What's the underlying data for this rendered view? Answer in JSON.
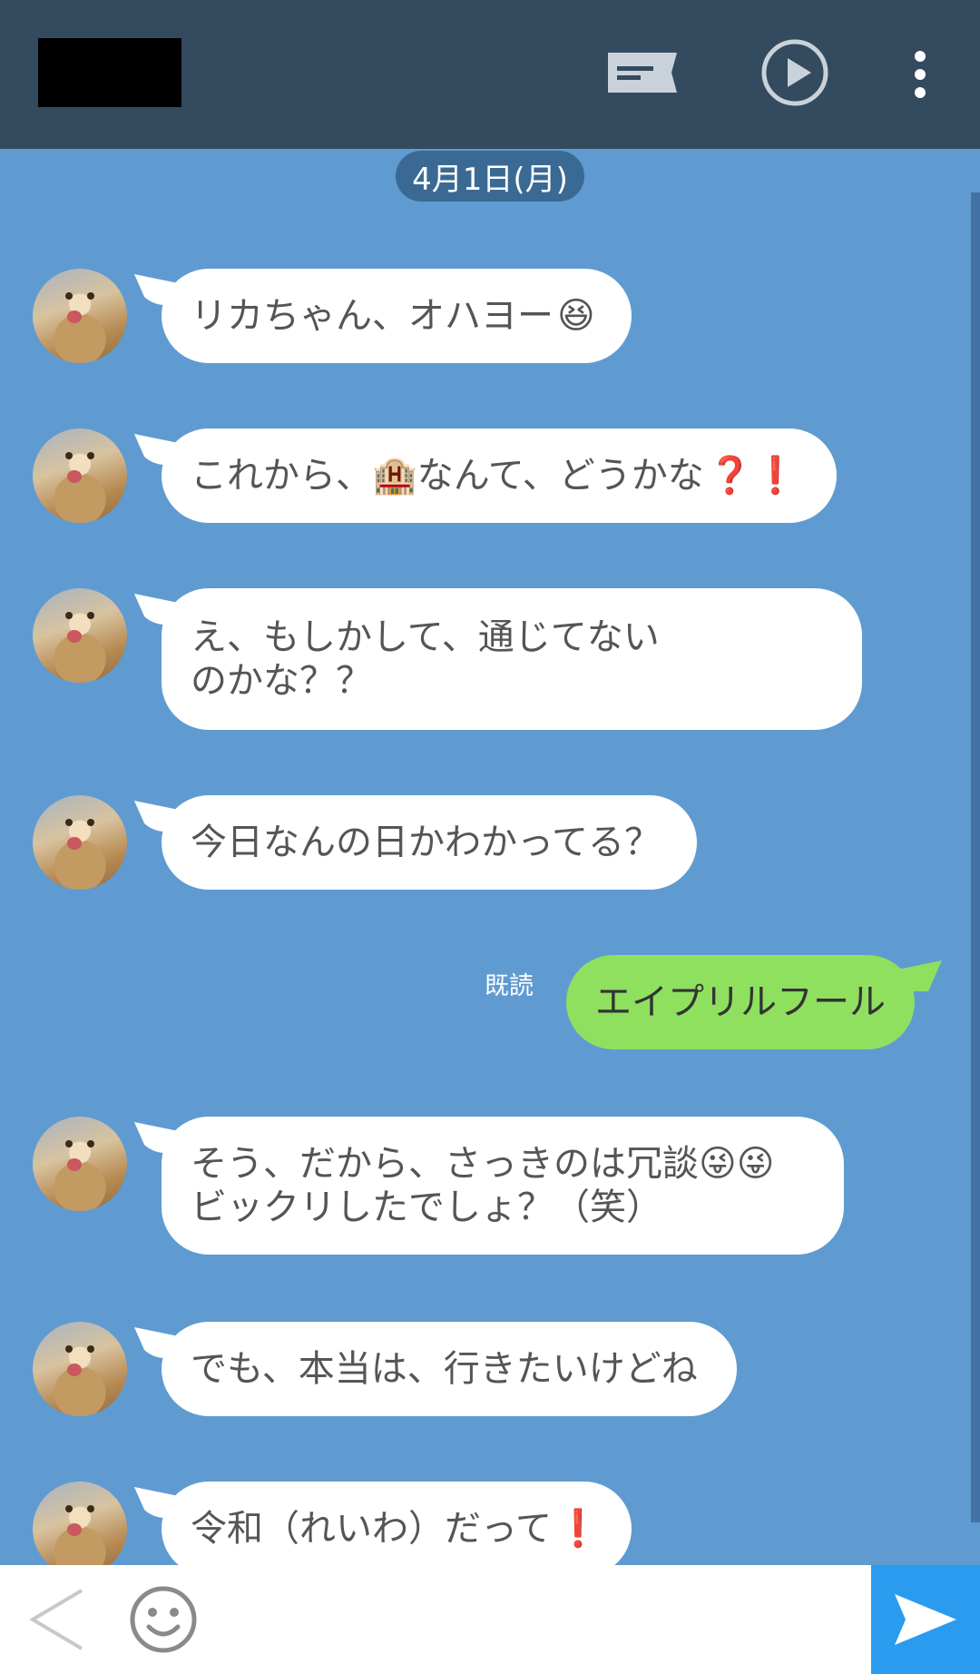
{
  "header": {
    "title_redacted": true,
    "icons": [
      "message-icon",
      "play-circle-icon",
      "more-vertical-icon"
    ]
  },
  "date": "4月1日(月)",
  "messages": [
    {
      "side": "left",
      "text": "リカちゃん、オハヨー",
      "emoji": "😆"
    },
    {
      "side": "left",
      "text": "これから、🏨なんて、どうかな",
      "emoji": "❓❗"
    },
    {
      "side": "left",
      "text": "え、もしかして、通じてない\nのかな？？",
      "emoji": ""
    },
    {
      "side": "left",
      "text": "今日なんの日かわかってる？",
      "emoji": ""
    },
    {
      "side": "right",
      "text": "エイプリルフール",
      "emoji": "",
      "read": "既読"
    },
    {
      "side": "left",
      "text": "そう、だから、さっきのは冗談😜😜\nビックリしたでしょ？（笑）",
      "emoji": ""
    },
    {
      "side": "left",
      "text": "でも、本当は、行きたいけどね",
      "emoji": ""
    },
    {
      "side": "left",
      "text": "令和（れいわ）だって",
      "emoji": "❗"
    }
  ],
  "footer": {
    "icons": [
      "back-chevron-icon",
      "smiley-icon",
      "send-icon"
    ]
  },
  "colors": {
    "header_bg": "#344a5e",
    "chat_bg": "#5f9bd1",
    "left_bubble": "#ffffff",
    "right_bubble": "#8fe05f",
    "send_button": "#2b9bf0"
  }
}
